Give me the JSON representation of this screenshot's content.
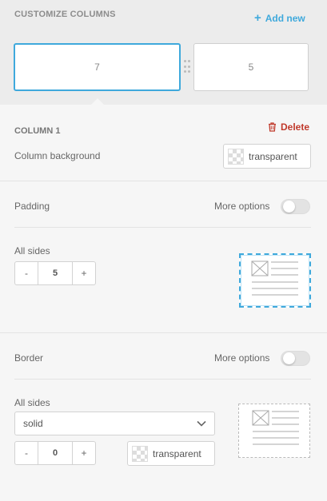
{
  "header": {
    "title": "CUSTOMIZE COLUMNS",
    "add_new": "Add new",
    "columns": [
      {
        "label": "7",
        "active": true
      },
      {
        "label": "5",
        "active": false
      }
    ]
  },
  "column": {
    "title": "COLUMN 1",
    "delete_label": "Delete",
    "background_label": "Column background",
    "background_value": "transparent"
  },
  "padding": {
    "title": "Padding",
    "more_options": "More options",
    "all_sides_label": "All sides",
    "minus": "-",
    "plus": "+",
    "value": "5",
    "more_options_enabled": false
  },
  "border": {
    "title": "Border",
    "more_options": "More options",
    "all_sides_label": "All sides",
    "style_value": "solid",
    "minus": "-",
    "plus": "+",
    "width_value": "0",
    "color_value": "transparent",
    "more_options_enabled": false
  },
  "colors": {
    "accent": "#3fa9dc",
    "danger": "#c0392b",
    "top_background": "#ececec",
    "panel_background": "#f6f6f6"
  },
  "icons": {
    "add": "plus-icon",
    "delete": "trash-icon",
    "drag": "drag-handle-icon",
    "select": "chevron-down-icon",
    "preview": "image-text-layout-icon"
  }
}
